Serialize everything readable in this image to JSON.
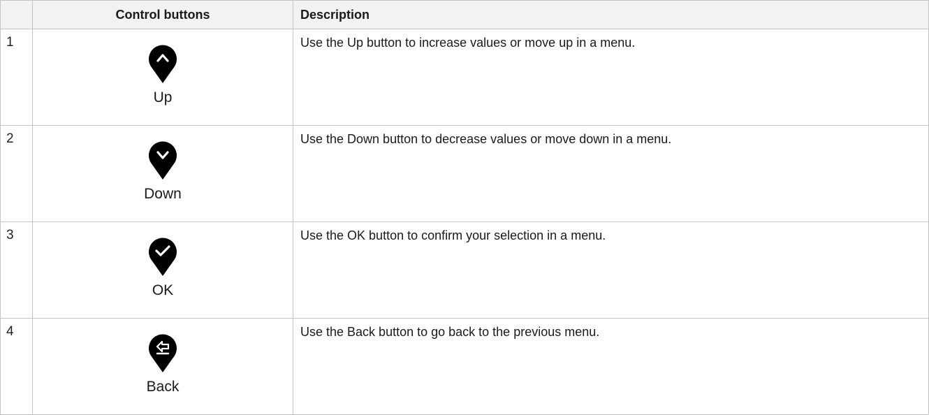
{
  "header": {
    "control_buttons": "Control buttons",
    "description": "Description"
  },
  "rows": [
    {
      "number": "1",
      "label": "Up",
      "icon": "chevron-up-icon",
      "description": "Use the Up button to increase values or move up in a menu."
    },
    {
      "number": "2",
      "label": "Down",
      "icon": "chevron-down-icon",
      "description": "Use the Down button to decrease values or move down in a menu."
    },
    {
      "number": "3",
      "label": "OK",
      "icon": "checkmark-icon",
      "description": "Use the OK button to confirm your selection in a menu."
    },
    {
      "number": "4",
      "label": "Back",
      "icon": "back-arrow-icon",
      "description": "Use the Back button to go back to the previous menu."
    }
  ],
  "colors": {
    "icon": "#000000",
    "header_bg": "#f2f2f2",
    "border": "#c4c4c4"
  }
}
